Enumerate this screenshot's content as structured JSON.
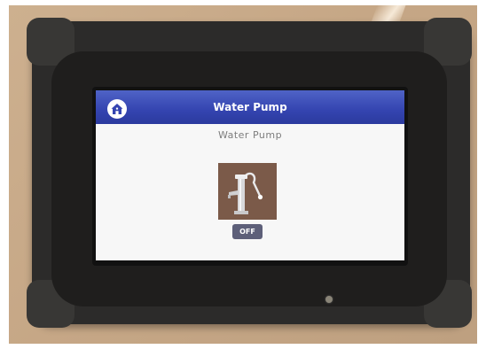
{
  "header": {
    "title": "Water Pump",
    "home_icon": "home-icon"
  },
  "device": {
    "subtitle": "Water Pump",
    "pump_icon": "hand-water-pump-icon",
    "state_button_label": "OFF"
  },
  "colors": {
    "header_blue": "#3444b0",
    "pump_tile_brown": "#7b5a49",
    "button_slate": "#5d5f79"
  }
}
